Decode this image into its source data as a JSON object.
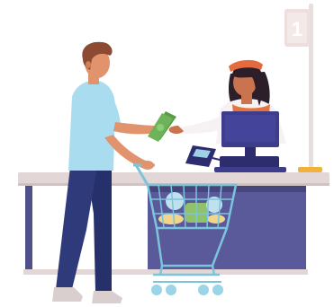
{
  "lane_sign": {
    "number": "1"
  },
  "colors": {
    "counter_top": "#e2d6d6",
    "counter_front": "#5a5a9b",
    "counter_leg": "#4f4f8a",
    "counter_shadow": "#46467c",
    "pole": "#e8dede",
    "sign_plate": "#eedede",
    "sign_text": "#ffffff",
    "pole_base": "#f0b23a",
    "customer_shirt": "#a9dcef",
    "customer_pants": "#2f3a7a",
    "customer_skin": "#e0936c",
    "customer_hair": "#8c4a32",
    "customer_shoes": "#d9cfcf",
    "cash": "#6eb35a",
    "cashier_skin": "#c9744e",
    "cashier_hair": "#2c1f2a",
    "cashier_visor": "#e56a3e",
    "cashier_apron": "#e5733e",
    "cashier_shirt": "#f6f1f3",
    "register_monitor": "#3d3d8c",
    "register_base": "#2c2c6e",
    "card_reader": "#2c2c6e",
    "card_reader_screen": "#9fd0ea",
    "cart_frame": "#7cc4dc",
    "cart_wheel": "#9ad4e6",
    "groceries_green": "#8fc26a",
    "groceries_yellow": "#efd68c",
    "groceries_blue": "#bfe1ee"
  }
}
